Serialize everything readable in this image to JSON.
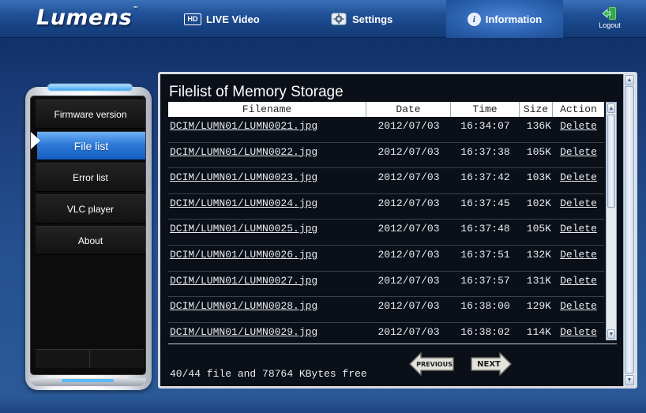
{
  "header": {
    "logo_text": "Lumens",
    "logo_mark": "™",
    "nav": [
      {
        "label": "LIVE Video",
        "icon": "hd-icon",
        "icon_text": "HD"
      },
      {
        "label": "Settings",
        "icon": "gear-icon"
      },
      {
        "label": "Information",
        "icon": "info-icon",
        "icon_text": "i",
        "active": true
      }
    ],
    "logout_label": "Logout"
  },
  "sidebar": {
    "items": [
      {
        "label": "Firmware version"
      },
      {
        "label": "File list",
        "active": true
      },
      {
        "label": "Error list"
      },
      {
        "label": "VLC player"
      },
      {
        "label": "About"
      }
    ]
  },
  "main": {
    "title": "Filelist of Memory Storage",
    "columns": [
      "Filename",
      "Date",
      "Time",
      "Size",
      "Action"
    ],
    "rows": [
      {
        "filename": "DCIM/LUMN01/LUMN0021.jpg",
        "date": "2012/07/03",
        "time": "16:34:07",
        "size": "136K",
        "action": "Delete"
      },
      {
        "filename": "DCIM/LUMN01/LUMN0022.jpg",
        "date": "2012/07/03",
        "time": "16:37:38",
        "size": "105K",
        "action": "Delete"
      },
      {
        "filename": "DCIM/LUMN01/LUMN0023.jpg",
        "date": "2012/07/03",
        "time": "16:37:42",
        "size": "103K",
        "action": "Delete"
      },
      {
        "filename": "DCIM/LUMN01/LUMN0024.jpg",
        "date": "2012/07/03",
        "time": "16:37:45",
        "size": "102K",
        "action": "Delete"
      },
      {
        "filename": "DCIM/LUMN01/LUMN0025.jpg",
        "date": "2012/07/03",
        "time": "16:37:48",
        "size": "105K",
        "action": "Delete"
      },
      {
        "filename": "DCIM/LUMN01/LUMN0026.jpg",
        "date": "2012/07/03",
        "time": "16:37:51",
        "size": "132K",
        "action": "Delete"
      },
      {
        "filename": "DCIM/LUMN01/LUMN0027.jpg",
        "date": "2012/07/03",
        "time": "16:37:57",
        "size": "131K",
        "action": "Delete"
      },
      {
        "filename": "DCIM/LUMN01/LUMN0028.jpg",
        "date": "2012/07/03",
        "time": "16:38:00",
        "size": "129K",
        "action": "Delete"
      },
      {
        "filename": "DCIM/LUMN01/LUMN0029.jpg",
        "date": "2012/07/03",
        "time": "16:38:02",
        "size": "114K",
        "action": "Delete"
      }
    ],
    "status": "40/44 file and 78764 KBytes free",
    "prev_label": "PREVIOUS",
    "next_label": "NEXT"
  },
  "colors": {
    "accent": "#2e7ad8",
    "background": "#1a3c78",
    "panel": "#0a0f18"
  }
}
